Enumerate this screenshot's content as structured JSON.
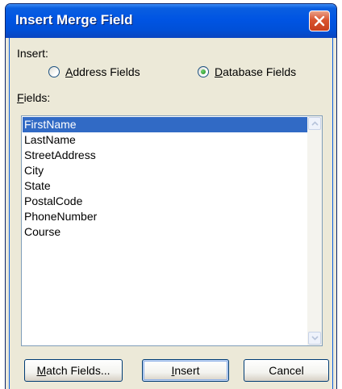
{
  "dialog": {
    "title": "Insert Merge Field"
  },
  "insert": {
    "label": "Insert:",
    "options": [
      {
        "accel": "A",
        "rest": "ddress Fields",
        "selected": false
      },
      {
        "accel": "D",
        "rest": "atabase Fields",
        "selected": true
      }
    ]
  },
  "fields": {
    "label_accel": "F",
    "label_rest": "ields:",
    "items": [
      "FirstName",
      "LastName",
      "StreetAddress",
      "City",
      "State",
      "PostalCode",
      "PhoneNumber",
      "Course"
    ],
    "selected_index": 0
  },
  "buttons": {
    "match_accel": "M",
    "match_rest": "atch Fields...",
    "insert_accel": "I",
    "insert_rest": "nsert",
    "cancel": "Cancel"
  },
  "icons": {
    "close": "close-icon",
    "scroll_up": "scroll-up-arrow-icon",
    "scroll_down": "scroll-down-arrow-icon"
  },
  "colors": {
    "titlebar": "#0054e3",
    "selection": "#316ac5",
    "dialog_bg": "#ece9d8",
    "close_button": "#d9542f"
  }
}
